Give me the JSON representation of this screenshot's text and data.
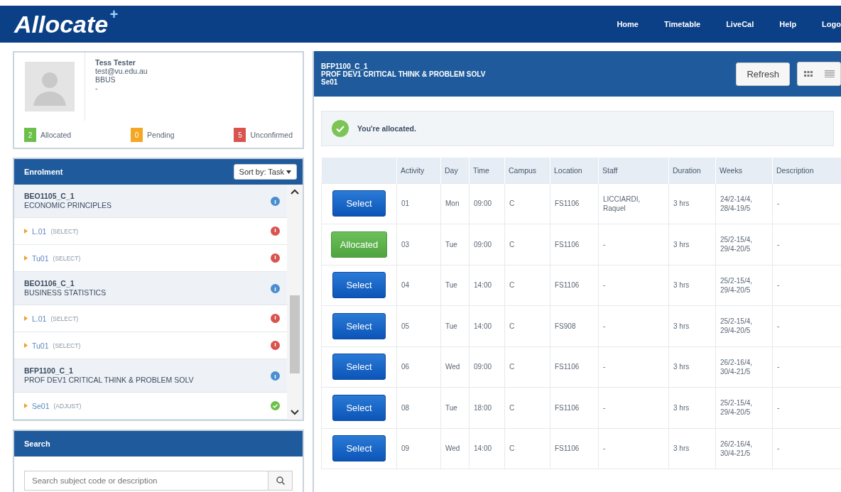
{
  "header": {
    "logo": "Allocate",
    "logo_mark": "+",
    "nav": [
      "Home",
      "Timetable",
      "LiveCal",
      "Help",
      "Logo"
    ]
  },
  "profile": {
    "name": "Tess Tester",
    "email": "test@vu.edu.au",
    "course": "BBUS",
    "note": "-",
    "counts": [
      {
        "count": "2",
        "label": "Allocated",
        "color": "#6cc04a"
      },
      {
        "count": "0",
        "label": "Pending",
        "color": "#f5a623"
      },
      {
        "count": "5",
        "label": "Unconfirmed",
        "color": "#d9534f"
      }
    ]
  },
  "enrolment": {
    "title": "Enrolment",
    "sort": "Sort by: Task",
    "items": [
      {
        "code": "BEO1105_C_1",
        "title": "ECONOMIC PRINCIPLES",
        "kind": "info",
        "children": [
          {
            "code": "L.01",
            "action": "(SELECT)",
            "kind": "error"
          },
          {
            "code": "Tu01",
            "action": "(SELECT)",
            "kind": "error"
          }
        ]
      },
      {
        "code": "BEO1106_C_1",
        "title": "BUSINESS STATISTICS",
        "kind": "info",
        "children": [
          {
            "code": "L.01",
            "action": "(SELECT)",
            "kind": "error"
          },
          {
            "code": "Tu01",
            "action": "(SELECT)",
            "kind": "error"
          }
        ]
      },
      {
        "code": "BFP1100_C_1",
        "title": "PROF DEV1 CRITICAL THINK & PROBLEM SOLV",
        "kind": "info",
        "children": [
          {
            "code": "Se01",
            "action": "(ADJUST)",
            "kind": "ok"
          }
        ]
      }
    ]
  },
  "search": {
    "title": "Search",
    "placeholder": "Search subject code or description"
  },
  "detail": {
    "code": "BFP1100_C_1",
    "title": "PROF DEV1 CRITICAL THINK & PROBLEM SOLV",
    "group": "Se01",
    "refresh": "Refresh",
    "alert": "You're allocated.",
    "table": {
      "columns": [
        "Activity",
        "Day",
        "Time",
        "Campus",
        "Location",
        "Staff",
        "Duration",
        "Weeks",
        "Description"
      ],
      "rows": [
        {
          "action": {
            "label": "Select",
            "kind": "select"
          },
          "cells": [
            "01",
            "Mon",
            "09:00",
            "C",
            "FS1106",
            "LICCIARDI, Raquel",
            "3 hrs",
            "24/2-14/4, 28/4-19/5",
            "-"
          ]
        },
        {
          "action": {
            "label": "Allocated",
            "kind": "allocated"
          },
          "cells": [
            "03",
            "Tue",
            "09:00",
            "C",
            "FS1106",
            "-",
            "3 hrs",
            "25/2-15/4, 29/4-20/5",
            "-"
          ]
        },
        {
          "action": {
            "label": "Select",
            "kind": "select"
          },
          "cells": [
            "04",
            "Tue",
            "14:00",
            "C",
            "FS1106",
            "-",
            "3 hrs",
            "25/2-15/4, 29/4-20/5",
            "-"
          ]
        },
        {
          "action": {
            "label": "Select",
            "kind": "select"
          },
          "cells": [
            "05",
            "Tue",
            "14:00",
            "C",
            "FS908",
            "-",
            "3 hrs",
            "25/2-15/4, 29/4-20/5",
            "-"
          ]
        },
        {
          "action": {
            "label": "Select",
            "kind": "select"
          },
          "cells": [
            "06",
            "Wed",
            "09:00",
            "C",
            "FS1106",
            "-",
            "3 hrs",
            "26/2-16/4, 30/4-21/5",
            "-"
          ]
        },
        {
          "action": {
            "label": "Select",
            "kind": "select"
          },
          "cells": [
            "08",
            "Tue",
            "18:00",
            "C",
            "FS1106",
            "-",
            "3 hrs",
            "25/2-15/4, 29/4-20/5",
            "-"
          ]
        },
        {
          "action": {
            "label": "Select",
            "kind": "select"
          },
          "cells": [
            "09",
            "Wed",
            "14:00",
            "C",
            "FS1106",
            "-",
            "3 hrs",
            "26/2-16/4, 30/4-21/5",
            "-"
          ]
        }
      ]
    }
  }
}
